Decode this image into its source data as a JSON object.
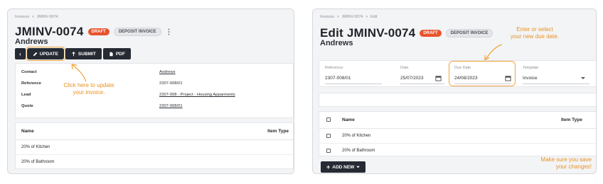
{
  "left": {
    "breadcrumb": [
      "Invoices",
      ">",
      "JMINV-0074"
    ],
    "title": "JMINV-0074",
    "badge_status": "DRAFT",
    "badge_type": "DEPOSIT INVOICE",
    "kebab": "⋮",
    "subtitle": "Andrews",
    "toolbar": {
      "back": "‹",
      "update": "UPDATE",
      "submit": "SUBMIT",
      "pdf": "PDF"
    },
    "details": [
      {
        "label": "Contact",
        "value": "Andrews"
      },
      {
        "label": "Reference",
        "value": "2307-008/01"
      },
      {
        "label": "Lead",
        "value": "2307-008 - Project - Housing Apparments"
      },
      {
        "label": "Quote",
        "value": "2307-008/01"
      }
    ],
    "annotation": "Click here to update\nyour invoice.",
    "list_headers": {
      "name": "Name",
      "item_type": "Item Type"
    },
    "list_rows": [
      "20% of Kitchen",
      "20% of Bathroom"
    ]
  },
  "right": {
    "breadcrumb": [
      "Invoices",
      ">",
      "JMINV-0074",
      ">",
      "Edit"
    ],
    "title": "Edit JMINV-0074",
    "badge_status": "DRAFT",
    "badge_type": "DEPOSIT INVOICE",
    "subtitle": "Andrews",
    "form": {
      "reference_label": "Reference",
      "reference_value": "2307-008/01",
      "date_label": "Date",
      "date_value": "25/07/2023",
      "due_label": "Due Date",
      "due_value": "24/08/2023",
      "template_label": "Template",
      "template_value": "Invoice"
    },
    "annotation_due": "Enter or select\nyour new due date.",
    "table_headers": {
      "name": "Name",
      "item_type": "Item Type"
    },
    "table_rows": [
      "20% of Kitchen",
      "20% of Bathroom"
    ],
    "add_new": "ADD NEW",
    "annotation_save": "Make sure you save\nyour changes!"
  },
  "colors": {
    "accent_orange": "#f0a43a",
    "draft_red": "#e8542d",
    "button_dark": "#262a33"
  }
}
